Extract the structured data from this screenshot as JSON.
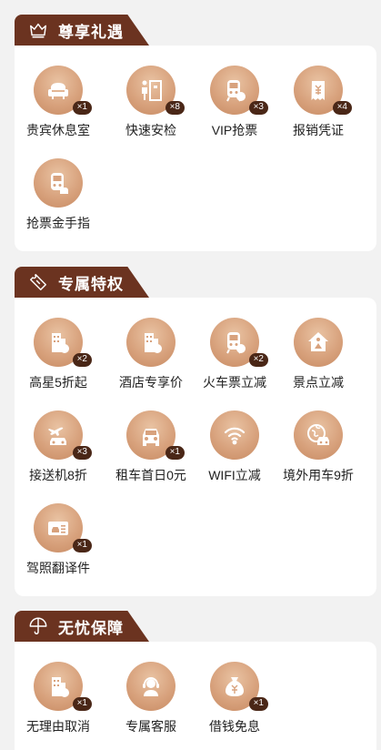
{
  "sections": [
    {
      "title": "尊享礼遇",
      "icon": "crown-icon",
      "items": [
        {
          "label": "贵宾休息室",
          "badge": "×1",
          "icon": "sofa-icon"
        },
        {
          "label": "快速安检",
          "badge": "×8",
          "icon": "security-gate-icon"
        },
        {
          "label": "VIP抢票",
          "badge": "×3",
          "icon": "train-ticket-icon"
        },
        {
          "label": "报销凭证",
          "badge": "×4",
          "icon": "receipt-icon"
        },
        {
          "label": "抢票金手指",
          "badge": "",
          "icon": "train-hand-icon"
        }
      ]
    },
    {
      "title": "专属特权",
      "icon": "ticket-icon",
      "items": [
        {
          "label": "高星5折起",
          "badge": "×2",
          "icon": "hotel-star-icon"
        },
        {
          "label": "酒店专享价",
          "badge": "",
          "icon": "hotel-price-icon"
        },
        {
          "label": "火车票立减",
          "badge": "×2",
          "icon": "train-discount-icon"
        },
        {
          "label": "景点立减",
          "badge": "",
          "icon": "attraction-icon"
        },
        {
          "label": "接送机8折",
          "badge": "×3",
          "icon": "airport-transfer-icon"
        },
        {
          "label": "租车首日0元",
          "badge": "×1",
          "icon": "car-rental-icon"
        },
        {
          "label": "WIFI立减",
          "badge": "",
          "icon": "wifi-icon"
        },
        {
          "label": "境外用车9折",
          "badge": "",
          "icon": "overseas-car-icon"
        },
        {
          "label": "驾照翻译件",
          "badge": "×1",
          "icon": "license-icon"
        }
      ]
    },
    {
      "title": "无忧保障",
      "icon": "umbrella-icon",
      "items": [
        {
          "label": "无理由取消",
          "badge": "×1",
          "icon": "cancel-building-icon"
        },
        {
          "label": "专属客服",
          "badge": "",
          "icon": "customer-service-icon"
        },
        {
          "label": "借钱免息",
          "badge": "×1",
          "icon": "money-bag-icon"
        }
      ]
    }
  ],
  "colors": {
    "tab": "#6b3320",
    "badge": "#4a2717",
    "circle": "#d8a27d",
    "background": "#f2f2f2"
  }
}
